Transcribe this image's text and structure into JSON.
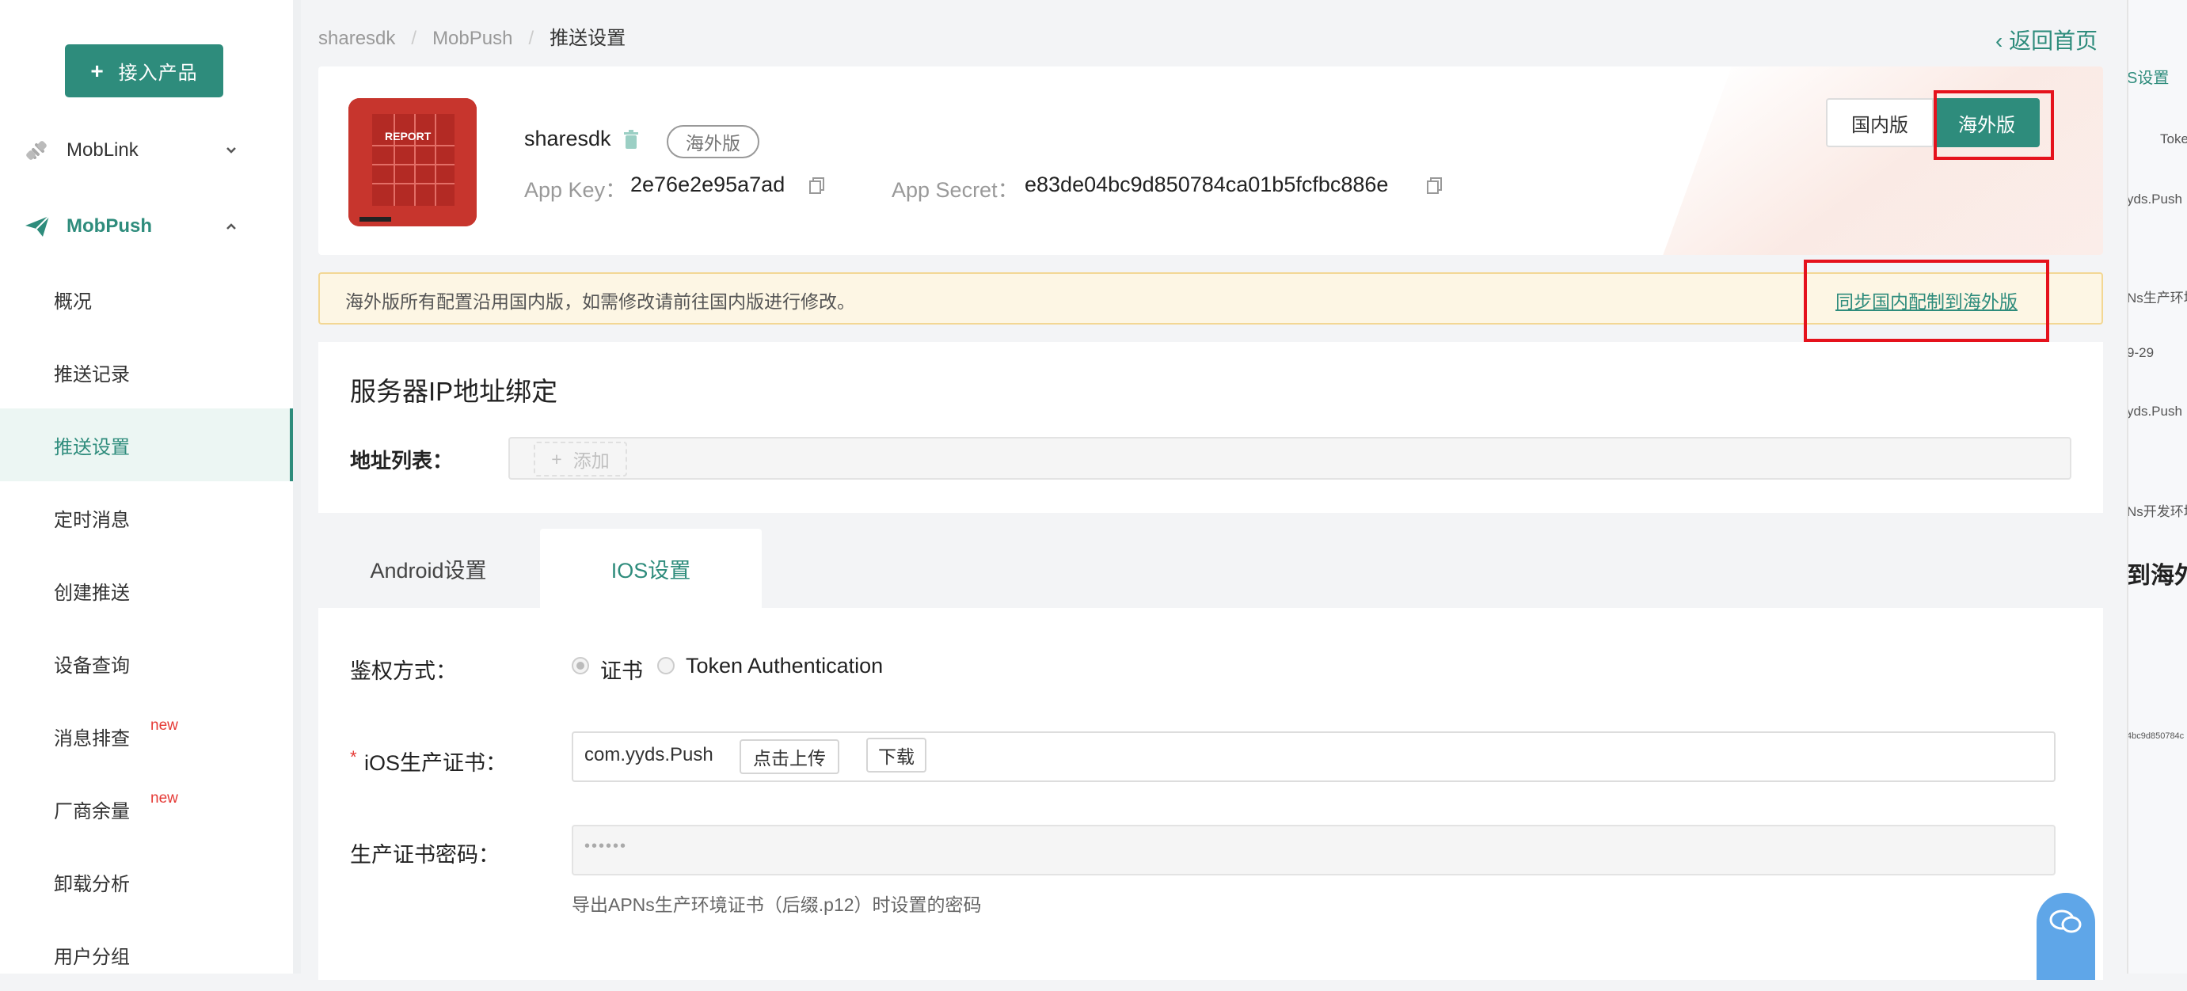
{
  "sidebar": {
    "add_product": "接入产品",
    "groups": [
      {
        "label": "MobLink"
      },
      {
        "label": "MobPush"
      }
    ],
    "items": [
      {
        "label": "概况",
        "badge": ""
      },
      {
        "label": "推送记录",
        "badge": ""
      },
      {
        "label": "推送设置",
        "badge": ""
      },
      {
        "label": "定时消息",
        "badge": ""
      },
      {
        "label": "创建推送",
        "badge": ""
      },
      {
        "label": "设备查询",
        "badge": ""
      },
      {
        "label": "消息排查",
        "badge": "new"
      },
      {
        "label": "厂商余量",
        "badge": "new"
      },
      {
        "label": "卸载分析",
        "badge": ""
      },
      {
        "label": "用户分组",
        "badge": ""
      }
    ],
    "active_item": "推送设置"
  },
  "breadcrumb": [
    "sharesdk",
    "MobPush",
    "推送设置"
  ],
  "back_home": "返回首页",
  "app": {
    "name": "sharesdk",
    "edition_tag": "海外版",
    "app_key_label": "App Key：",
    "app_key": "2e76e2e95a7ad",
    "app_secret_label": "App Secret：",
    "app_secret": "e83de04bc9d850784ca01b5fcfbc886e",
    "logo_text": "REPORT"
  },
  "region_toggle": {
    "domestic": "国内版",
    "overseas": "海外版",
    "selected": "海外版"
  },
  "notice": {
    "text": "海外版所有配置沿用国内版，如需修改请前往国内版进行修改。",
    "link": "同步国内配制到海外版"
  },
  "ip_binding": {
    "title": "服务器IP地址绑定",
    "list_label": "地址列表：",
    "add_label": "添加"
  },
  "tabs": [
    {
      "label": "Android设置",
      "active": false
    },
    {
      "label": "IOS设置",
      "active": true
    }
  ],
  "ios_settings": {
    "auth_label": "鉴权方式：",
    "auth_options": [
      "证书",
      "Token Authentication"
    ],
    "auth_selected": "证书",
    "prod_cert_label": "iOS生产证书：",
    "prod_cert_value": "com.yyds.Push",
    "upload_label": "点击上传",
    "download_label": "下载",
    "pwd_label": "生产证书密码：",
    "pwd_value": "••••••",
    "pwd_hint": "导出APNs生产环境证书（后缀.p12）时设置的密码"
  },
  "side_peek": [
    "S设置",
    "Toke",
    "yds.Push",
    "Ns生产环境",
    "9-29",
    "yds.Push",
    "Ns开发环境",
    "到海外",
    "4bc9d850784c"
  ],
  "colors": {
    "accent": "#2e8c7c",
    "highlight": "#e5121c",
    "badge": "#e53935",
    "notice_bg": "#fdf6e4"
  }
}
